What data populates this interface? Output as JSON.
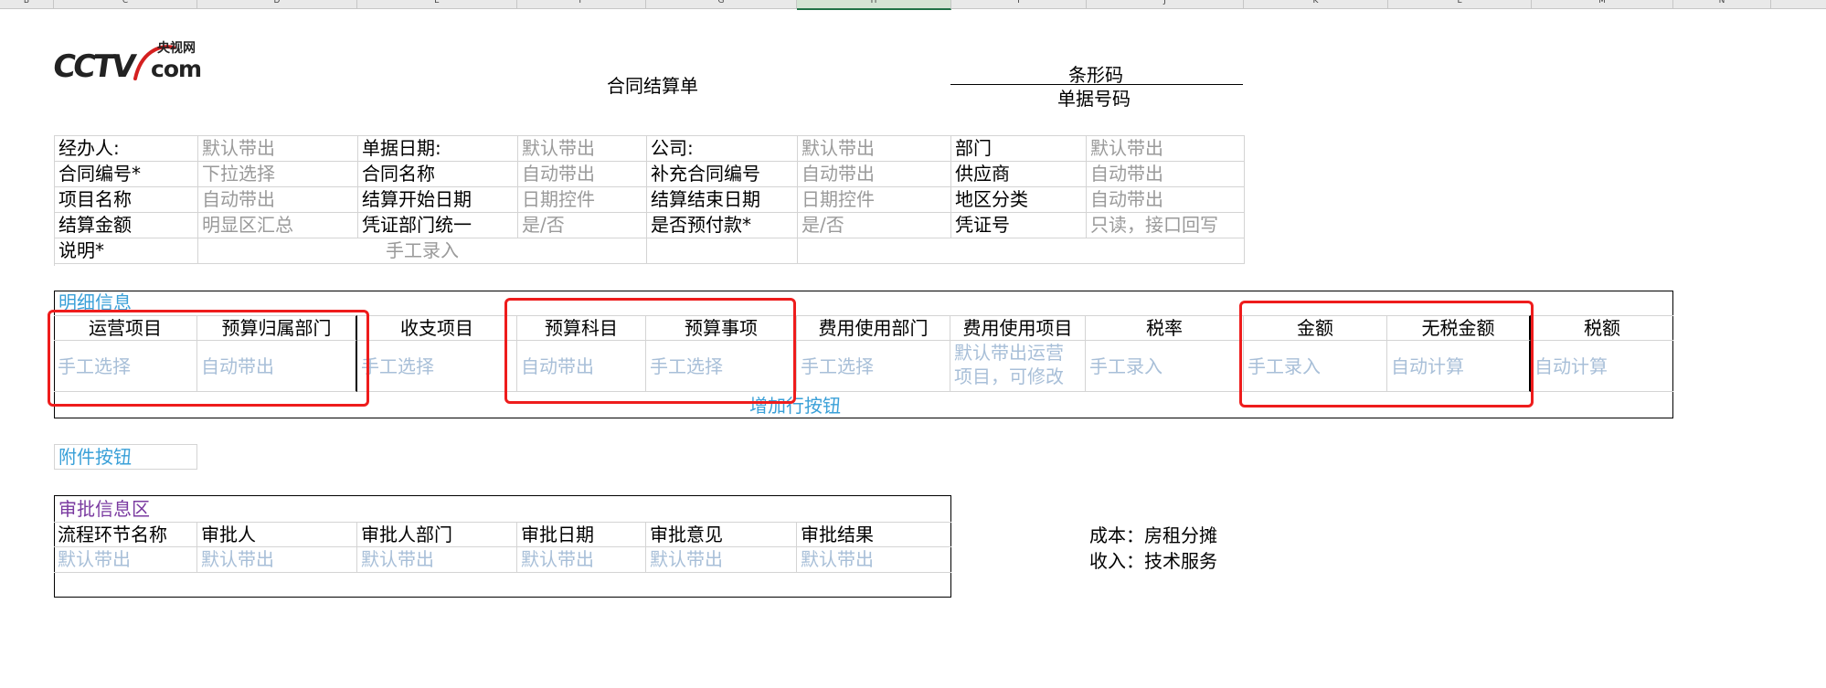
{
  "column_headers": [
    "B",
    "C",
    "D",
    "E",
    "F",
    "G",
    "H",
    "I",
    "J",
    "K",
    "L",
    "M",
    "N"
  ],
  "logo": {
    "latin": "CCTV",
    "suffix": "com",
    "chinese": "央视网"
  },
  "form": {
    "title": "合同结算单",
    "barcode_label": "条形码",
    "doc_number_label": "单据号码"
  },
  "header_fields": [
    [
      {
        "label": "经办人:",
        "value": "默认带出"
      },
      {
        "label": "单据日期:",
        "value": "默认带出"
      },
      {
        "label": "公司:",
        "value": "默认带出"
      },
      {
        "label": "部门",
        "value": "默认带出"
      }
    ],
    [
      {
        "label": "合同编号*",
        "value": "下拉选择"
      },
      {
        "label": "合同名称",
        "value": "自动带出"
      },
      {
        "label": "补充合同编号",
        "value": "自动带出"
      },
      {
        "label": "供应商",
        "value": "自动带出"
      }
    ],
    [
      {
        "label": "项目名称",
        "value": "自动带出"
      },
      {
        "label": "结算开始日期",
        "value": "日期控件"
      },
      {
        "label": "结算结束日期",
        "value": "日期控件"
      },
      {
        "label": "地区分类",
        "value": "自动带出"
      }
    ],
    [
      {
        "label": "结算金额",
        "value": "明显区汇总"
      },
      {
        "label": "凭证部门统一",
        "value": "是/否"
      },
      {
        "label": "是否预付款*",
        "value": "是/否"
      },
      {
        "label": "凭证号",
        "value": "只读，接口回写"
      }
    ]
  ],
  "description": {
    "label": "说明*",
    "value": "手工录入"
  },
  "detail": {
    "section_title": "明细信息",
    "columns": [
      "运营项目",
      "预算归属部门",
      "收支项目",
      "预算科目",
      "预算事项",
      "费用使用部门",
      "费用使用项目",
      "税率",
      "金额",
      "无税金额",
      "税额"
    ],
    "row": [
      "手工选择",
      "自动带出",
      "手工选择",
      "自动带出",
      "手工选择",
      "手工选择",
      "默认带出运营",
      "手工录入",
      "手工录入",
      "自动计算",
      "自动计算"
    ],
    "row_second_line": "项目，可修改",
    "add_row_button": "增加行按钮"
  },
  "attachment_button": "附件按钮",
  "approval": {
    "section_title": "审批信息区",
    "columns": [
      "流程环节名称",
      "审批人",
      "审批人部门",
      "审批日期",
      "审批意见",
      "审批结果"
    ],
    "row": [
      "默认带出",
      "默认带出",
      "默认带出",
      "默认带出",
      "默认带出",
      "默认带出"
    ]
  },
  "notes": {
    "cost": "成本：房租分摊",
    "income": "收入：技术服务"
  },
  "colors": {
    "highlight_red": "#ee1c1c",
    "link_blue": "#3aa0d8",
    "section_purple": "#7a3aa0",
    "placeholder_gray": "#9a9a9a"
  }
}
